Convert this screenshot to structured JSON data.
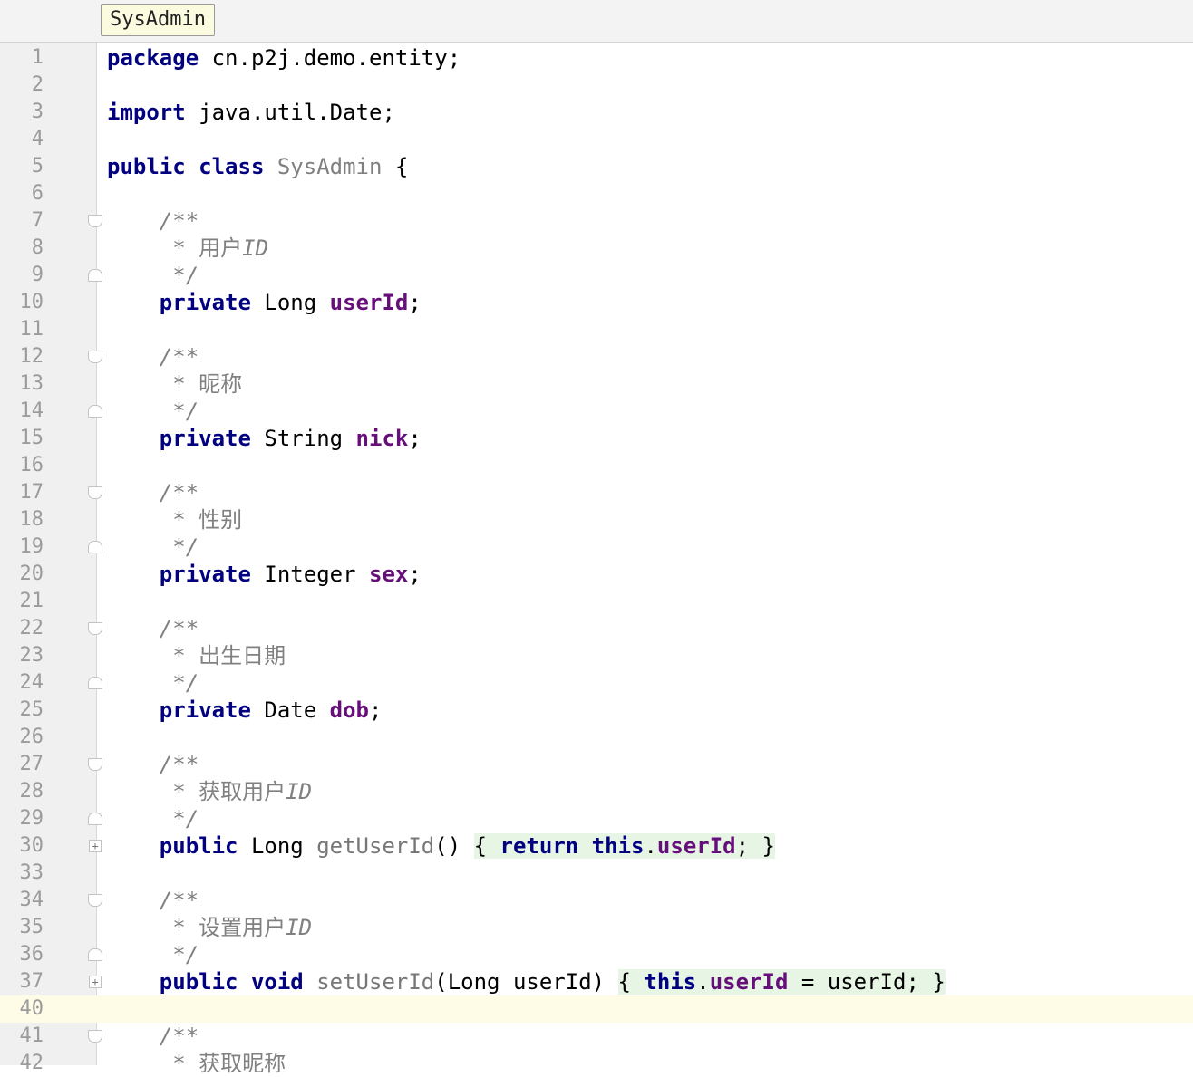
{
  "breadcrumb": {
    "label": "SysAdmin"
  },
  "editor": {
    "current_line": "40",
    "lines": [
      {
        "n": "1",
        "fold": "",
        "tokens": [
          {
            "t": "package",
            "c": "kw"
          },
          {
            "t": " cn.p2j.demo.entity;",
            "c": ""
          }
        ]
      },
      {
        "n": "2",
        "fold": "",
        "tokens": []
      },
      {
        "n": "3",
        "fold": "",
        "tokens": [
          {
            "t": "import",
            "c": "kw"
          },
          {
            "t": " java.util.Date;",
            "c": ""
          }
        ]
      },
      {
        "n": "4",
        "fold": "",
        "tokens": []
      },
      {
        "n": "5",
        "fold": "",
        "tokens": [
          {
            "t": "public",
            "c": "kw"
          },
          {
            "t": " ",
            "c": ""
          },
          {
            "t": "class",
            "c": "kw"
          },
          {
            "t": " ",
            "c": ""
          },
          {
            "t": "SysAdmin",
            "c": "cls"
          },
          {
            "t": " {",
            "c": ""
          }
        ]
      },
      {
        "n": "6",
        "fold": "",
        "tokens": []
      },
      {
        "n": "7",
        "fold": "open",
        "tokens": [
          {
            "t": "    /**",
            "c": "cmt"
          }
        ]
      },
      {
        "n": "8",
        "fold": "",
        "tokens": [
          {
            "t": "     * ",
            "c": "cmt"
          },
          {
            "t": "用户",
            "c": "cmt-cjk"
          },
          {
            "t": "ID",
            "c": "cmt"
          }
        ]
      },
      {
        "n": "9",
        "fold": "close",
        "tokens": [
          {
            "t": "     */",
            "c": "cmt"
          }
        ]
      },
      {
        "n": "10",
        "fold": "",
        "tokens": [
          {
            "t": "    ",
            "c": ""
          },
          {
            "t": "private",
            "c": "kw"
          },
          {
            "t": " Long ",
            "c": ""
          },
          {
            "t": "userId",
            "c": "fld"
          },
          {
            "t": ";",
            "c": ""
          }
        ]
      },
      {
        "n": "11",
        "fold": "",
        "tokens": []
      },
      {
        "n": "12",
        "fold": "open",
        "tokens": [
          {
            "t": "    /**",
            "c": "cmt"
          }
        ]
      },
      {
        "n": "13",
        "fold": "",
        "tokens": [
          {
            "t": "     * ",
            "c": "cmt"
          },
          {
            "t": "昵称",
            "c": "cmt-cjk"
          }
        ]
      },
      {
        "n": "14",
        "fold": "close",
        "tokens": [
          {
            "t": "     */",
            "c": "cmt"
          }
        ]
      },
      {
        "n": "15",
        "fold": "",
        "tokens": [
          {
            "t": "    ",
            "c": ""
          },
          {
            "t": "private",
            "c": "kw"
          },
          {
            "t": " String ",
            "c": ""
          },
          {
            "t": "nick",
            "c": "fld"
          },
          {
            "t": ";",
            "c": ""
          }
        ]
      },
      {
        "n": "16",
        "fold": "",
        "tokens": []
      },
      {
        "n": "17",
        "fold": "open",
        "tokens": [
          {
            "t": "    /**",
            "c": "cmt"
          }
        ]
      },
      {
        "n": "18",
        "fold": "",
        "tokens": [
          {
            "t": "     * ",
            "c": "cmt"
          },
          {
            "t": "性别",
            "c": "cmt-cjk"
          }
        ]
      },
      {
        "n": "19",
        "fold": "close",
        "tokens": [
          {
            "t": "     */",
            "c": "cmt"
          }
        ]
      },
      {
        "n": "20",
        "fold": "",
        "tokens": [
          {
            "t": "    ",
            "c": ""
          },
          {
            "t": "private",
            "c": "kw"
          },
          {
            "t": " Integer ",
            "c": ""
          },
          {
            "t": "sex",
            "c": "fld"
          },
          {
            "t": ";",
            "c": ""
          }
        ]
      },
      {
        "n": "21",
        "fold": "",
        "tokens": []
      },
      {
        "n": "22",
        "fold": "open",
        "tokens": [
          {
            "t": "    /**",
            "c": "cmt"
          }
        ]
      },
      {
        "n": "23",
        "fold": "",
        "tokens": [
          {
            "t": "     * ",
            "c": "cmt"
          },
          {
            "t": "出生日期",
            "c": "cmt-cjk"
          }
        ]
      },
      {
        "n": "24",
        "fold": "close",
        "tokens": [
          {
            "t": "     */",
            "c": "cmt"
          }
        ]
      },
      {
        "n": "25",
        "fold": "",
        "tokens": [
          {
            "t": "    ",
            "c": ""
          },
          {
            "t": "private",
            "c": "kw"
          },
          {
            "t": " Date ",
            "c": ""
          },
          {
            "t": "dob",
            "c": "fld"
          },
          {
            "t": ";",
            "c": ""
          }
        ]
      },
      {
        "n": "26",
        "fold": "",
        "tokens": []
      },
      {
        "n": "27",
        "fold": "open",
        "tokens": [
          {
            "t": "    /**",
            "c": "cmt"
          }
        ]
      },
      {
        "n": "28",
        "fold": "",
        "tokens": [
          {
            "t": "     * ",
            "c": "cmt"
          },
          {
            "t": "获取用户",
            "c": "cmt-cjk"
          },
          {
            "t": "ID",
            "c": "cmt"
          }
        ]
      },
      {
        "n": "29",
        "fold": "close",
        "tokens": [
          {
            "t": "     */",
            "c": "cmt"
          }
        ]
      },
      {
        "n": "30",
        "fold": "collapsed",
        "tokens": [
          {
            "t": "    ",
            "c": ""
          },
          {
            "t": "public",
            "c": "kw"
          },
          {
            "t": " Long ",
            "c": ""
          },
          {
            "t": "getUserId",
            "c": "mth"
          },
          {
            "t": "() ",
            "c": ""
          },
          {
            "t": "{ ",
            "c": "brace"
          },
          {
            "t": "return",
            "c": "kw brace"
          },
          {
            "t": " ",
            "c": "brace"
          },
          {
            "t": "this",
            "c": "kw brace"
          },
          {
            "t": ".",
            "c": "brace"
          },
          {
            "t": "userId",
            "c": "fld brace"
          },
          {
            "t": "; }",
            "c": "brace"
          }
        ]
      },
      {
        "n": "33",
        "fold": "",
        "tokens": []
      },
      {
        "n": "34",
        "fold": "open",
        "tokens": [
          {
            "t": "    /**",
            "c": "cmt"
          }
        ]
      },
      {
        "n": "35",
        "fold": "",
        "tokens": [
          {
            "t": "     * ",
            "c": "cmt"
          },
          {
            "t": "设置用户",
            "c": "cmt-cjk"
          },
          {
            "t": "ID",
            "c": "cmt"
          }
        ]
      },
      {
        "n": "36",
        "fold": "close",
        "tokens": [
          {
            "t": "     */",
            "c": "cmt"
          }
        ]
      },
      {
        "n": "37",
        "fold": "collapsed",
        "tokens": [
          {
            "t": "    ",
            "c": ""
          },
          {
            "t": "public",
            "c": "kw"
          },
          {
            "t": " ",
            "c": ""
          },
          {
            "t": "void",
            "c": "kw"
          },
          {
            "t": " ",
            "c": ""
          },
          {
            "t": "setUserId",
            "c": "mth"
          },
          {
            "t": "(Long userId) ",
            "c": ""
          },
          {
            "t": "{ ",
            "c": "brace"
          },
          {
            "t": "this",
            "c": "kw brace"
          },
          {
            "t": ".",
            "c": "brace"
          },
          {
            "t": "userId",
            "c": "fld brace"
          },
          {
            "t": " = userId; }",
            "c": "brace"
          }
        ]
      },
      {
        "n": "40",
        "fold": "",
        "tokens": []
      },
      {
        "n": "41",
        "fold": "open",
        "tokens": [
          {
            "t": "    /**",
            "c": "cmt"
          }
        ]
      },
      {
        "n": "42",
        "fold": "",
        "tokens": [
          {
            "t": "     * ",
            "c": "cmt"
          },
          {
            "t": "获取昵称",
            "c": "cmt-cjk"
          }
        ]
      }
    ]
  }
}
